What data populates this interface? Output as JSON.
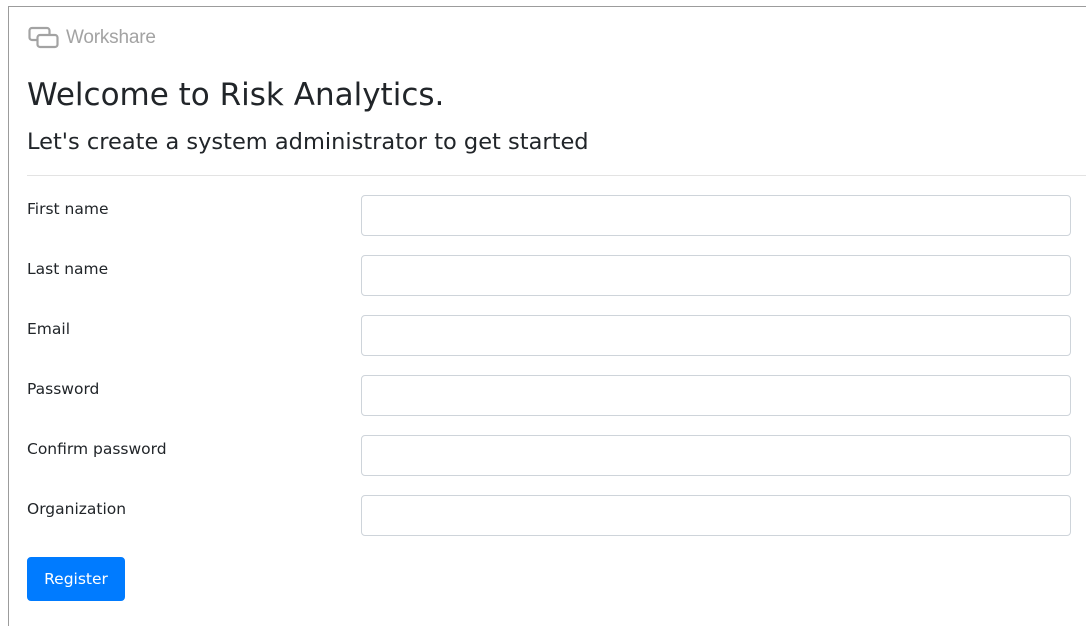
{
  "brand": {
    "name": "Workshare",
    "logo_icon": "workshare-logo-icon"
  },
  "page": {
    "title": "Welcome to Risk Analytics.",
    "subtitle": "Let's create a system administrator to get started"
  },
  "form": {
    "fields": [
      {
        "label": "First name",
        "value": ""
      },
      {
        "label": "Last name",
        "value": ""
      },
      {
        "label": "Email",
        "value": ""
      },
      {
        "label": "Password",
        "value": ""
      },
      {
        "label": "Confirm password",
        "value": ""
      },
      {
        "label": "Organization",
        "value": ""
      }
    ],
    "submit_label": "Register"
  },
  "colors": {
    "primary": "#007bff",
    "brand_gray": "#a3a3a3",
    "input_border": "#ced4da"
  }
}
